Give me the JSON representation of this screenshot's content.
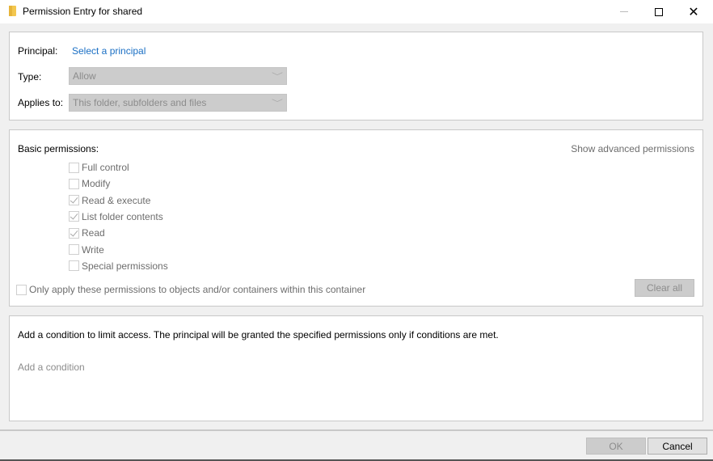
{
  "window": {
    "title": "Permission Entry for shared",
    "icon": "folder-icon",
    "controls": {
      "minimize": "minimize-icon",
      "maximize": "maximize-icon",
      "close": "✕"
    }
  },
  "principal_section": {
    "principal_label": "Principal:",
    "principal_link": "Select a principal",
    "type_label": "Type:",
    "type_value": "Allow",
    "applies_to_label": "Applies to:",
    "applies_to_value": "This folder, subfolders and files",
    "chevron": "﹀"
  },
  "permissions_section": {
    "heading": "Basic permissions:",
    "advanced_link": "Show advanced permissions",
    "items": [
      {
        "label": "Full control",
        "checked": false
      },
      {
        "label": "Modify",
        "checked": false
      },
      {
        "label": "Read & execute",
        "checked": true
      },
      {
        "label": "List folder contents",
        "checked": true
      },
      {
        "label": "Read",
        "checked": true
      },
      {
        "label": "Write",
        "checked": false
      },
      {
        "label": "Special permissions",
        "checked": false
      }
    ],
    "only_apply_label": "Only apply these permissions to objects and/or containers within this container",
    "only_apply_checked": false,
    "clear_all_label": "Clear all"
  },
  "condition_section": {
    "description": "Add a condition to limit access. The principal will be granted the specified permissions only if conditions are met.",
    "add_condition_label": "Add a condition"
  },
  "footer": {
    "ok_label": "OK",
    "cancel_label": "Cancel"
  }
}
